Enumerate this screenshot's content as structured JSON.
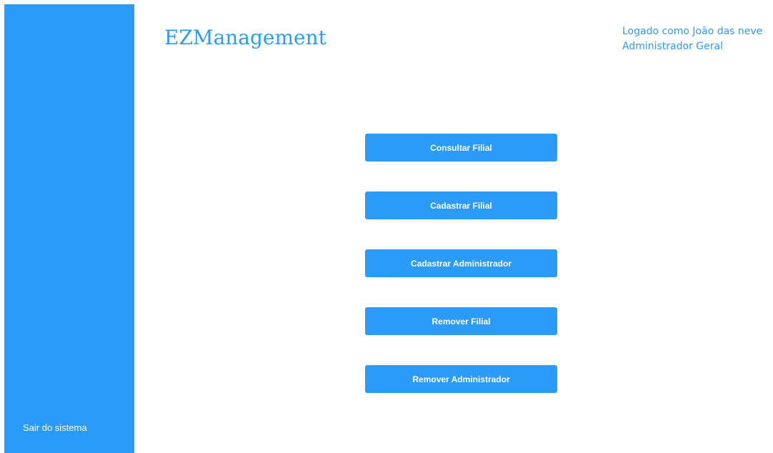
{
  "sidebar": {
    "logout_label": "Sair do sistema"
  },
  "header": {
    "brand": "EZManagement",
    "user_line": "Logado como João das neve",
    "role_line": "Administrador Geral"
  },
  "menu": {
    "items": [
      {
        "label": "Consultar Filial"
      },
      {
        "label": "Cadastrar Filial"
      },
      {
        "label": "Cadastrar Administrador"
      },
      {
        "label": "Remover Filial"
      },
      {
        "label": "Remover Administrador"
      }
    ]
  },
  "colors": {
    "accent": "#2b9bf7",
    "background": "#ffffff",
    "button_text": "#ffffff"
  }
}
